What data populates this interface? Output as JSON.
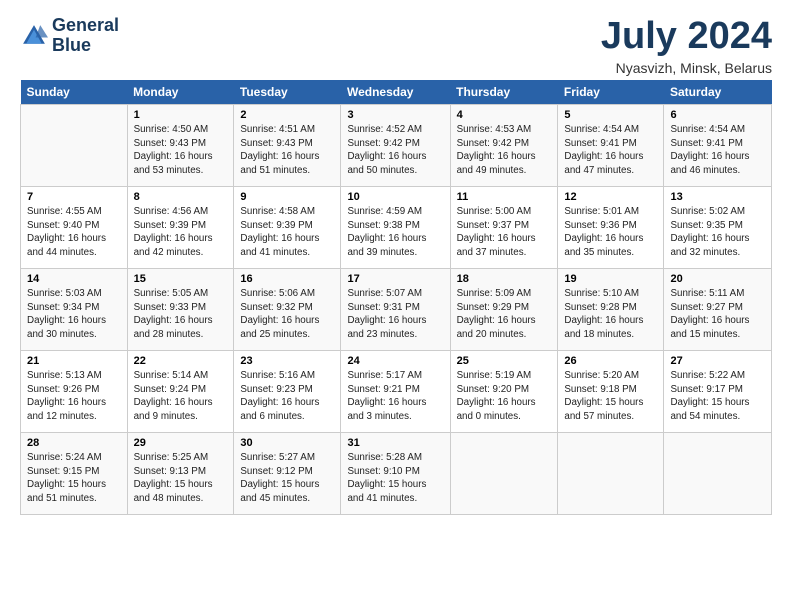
{
  "header": {
    "logo_line1": "General",
    "logo_line2": "Blue",
    "month_year": "July 2024",
    "location": "Nyasvizh, Minsk, Belarus"
  },
  "weekdays": [
    "Sunday",
    "Monday",
    "Tuesday",
    "Wednesday",
    "Thursday",
    "Friday",
    "Saturday"
  ],
  "weeks": [
    [
      {
        "day": "",
        "info": ""
      },
      {
        "day": "1",
        "info": "Sunrise: 4:50 AM\nSunset: 9:43 PM\nDaylight: 16 hours\nand 53 minutes."
      },
      {
        "day": "2",
        "info": "Sunrise: 4:51 AM\nSunset: 9:43 PM\nDaylight: 16 hours\nand 51 minutes."
      },
      {
        "day": "3",
        "info": "Sunrise: 4:52 AM\nSunset: 9:42 PM\nDaylight: 16 hours\nand 50 minutes."
      },
      {
        "day": "4",
        "info": "Sunrise: 4:53 AM\nSunset: 9:42 PM\nDaylight: 16 hours\nand 49 minutes."
      },
      {
        "day": "5",
        "info": "Sunrise: 4:54 AM\nSunset: 9:41 PM\nDaylight: 16 hours\nand 47 minutes."
      },
      {
        "day": "6",
        "info": "Sunrise: 4:54 AM\nSunset: 9:41 PM\nDaylight: 16 hours\nand 46 minutes."
      }
    ],
    [
      {
        "day": "7",
        "info": "Sunrise: 4:55 AM\nSunset: 9:40 PM\nDaylight: 16 hours\nand 44 minutes."
      },
      {
        "day": "8",
        "info": "Sunrise: 4:56 AM\nSunset: 9:39 PM\nDaylight: 16 hours\nand 42 minutes."
      },
      {
        "day": "9",
        "info": "Sunrise: 4:58 AM\nSunset: 9:39 PM\nDaylight: 16 hours\nand 41 minutes."
      },
      {
        "day": "10",
        "info": "Sunrise: 4:59 AM\nSunset: 9:38 PM\nDaylight: 16 hours\nand 39 minutes."
      },
      {
        "day": "11",
        "info": "Sunrise: 5:00 AM\nSunset: 9:37 PM\nDaylight: 16 hours\nand 37 minutes."
      },
      {
        "day": "12",
        "info": "Sunrise: 5:01 AM\nSunset: 9:36 PM\nDaylight: 16 hours\nand 35 minutes."
      },
      {
        "day": "13",
        "info": "Sunrise: 5:02 AM\nSunset: 9:35 PM\nDaylight: 16 hours\nand 32 minutes."
      }
    ],
    [
      {
        "day": "14",
        "info": "Sunrise: 5:03 AM\nSunset: 9:34 PM\nDaylight: 16 hours\nand 30 minutes."
      },
      {
        "day": "15",
        "info": "Sunrise: 5:05 AM\nSunset: 9:33 PM\nDaylight: 16 hours\nand 28 minutes."
      },
      {
        "day": "16",
        "info": "Sunrise: 5:06 AM\nSunset: 9:32 PM\nDaylight: 16 hours\nand 25 minutes."
      },
      {
        "day": "17",
        "info": "Sunrise: 5:07 AM\nSunset: 9:31 PM\nDaylight: 16 hours\nand 23 minutes."
      },
      {
        "day": "18",
        "info": "Sunrise: 5:09 AM\nSunset: 9:29 PM\nDaylight: 16 hours\nand 20 minutes."
      },
      {
        "day": "19",
        "info": "Sunrise: 5:10 AM\nSunset: 9:28 PM\nDaylight: 16 hours\nand 18 minutes."
      },
      {
        "day": "20",
        "info": "Sunrise: 5:11 AM\nSunset: 9:27 PM\nDaylight: 16 hours\nand 15 minutes."
      }
    ],
    [
      {
        "day": "21",
        "info": "Sunrise: 5:13 AM\nSunset: 9:26 PM\nDaylight: 16 hours\nand 12 minutes."
      },
      {
        "day": "22",
        "info": "Sunrise: 5:14 AM\nSunset: 9:24 PM\nDaylight: 16 hours\nand 9 minutes."
      },
      {
        "day": "23",
        "info": "Sunrise: 5:16 AM\nSunset: 9:23 PM\nDaylight: 16 hours\nand 6 minutes."
      },
      {
        "day": "24",
        "info": "Sunrise: 5:17 AM\nSunset: 9:21 PM\nDaylight: 16 hours\nand 3 minutes."
      },
      {
        "day": "25",
        "info": "Sunrise: 5:19 AM\nSunset: 9:20 PM\nDaylight: 16 hours\nand 0 minutes."
      },
      {
        "day": "26",
        "info": "Sunrise: 5:20 AM\nSunset: 9:18 PM\nDaylight: 15 hours\nand 57 minutes."
      },
      {
        "day": "27",
        "info": "Sunrise: 5:22 AM\nSunset: 9:17 PM\nDaylight: 15 hours\nand 54 minutes."
      }
    ],
    [
      {
        "day": "28",
        "info": "Sunrise: 5:24 AM\nSunset: 9:15 PM\nDaylight: 15 hours\nand 51 minutes."
      },
      {
        "day": "29",
        "info": "Sunrise: 5:25 AM\nSunset: 9:13 PM\nDaylight: 15 hours\nand 48 minutes."
      },
      {
        "day": "30",
        "info": "Sunrise: 5:27 AM\nSunset: 9:12 PM\nDaylight: 15 hours\nand 45 minutes."
      },
      {
        "day": "31",
        "info": "Sunrise: 5:28 AM\nSunset: 9:10 PM\nDaylight: 15 hours\nand 41 minutes."
      },
      {
        "day": "",
        "info": ""
      },
      {
        "day": "",
        "info": ""
      },
      {
        "day": "",
        "info": ""
      }
    ]
  ]
}
